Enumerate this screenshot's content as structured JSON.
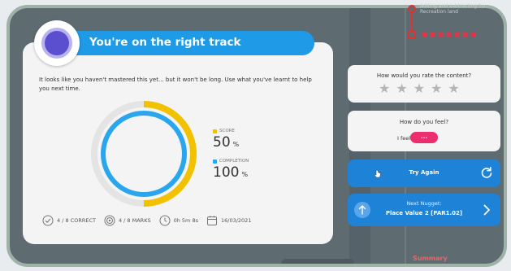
{
  "progress": {
    "nugget_title": "Adding and subtracting fro... Recreation land",
    "dot_count": 7
  },
  "result": {
    "title": "You're on the right track",
    "message": "It looks like you haven't mastered this yet... but it won't be long. Use what you've learnt to help you next time.",
    "score": {
      "label": "SCORE",
      "value": "50",
      "unit": "%",
      "fraction": 0.5,
      "color": "#f2c200"
    },
    "completion": {
      "label": "COMPLETION",
      "value": "100",
      "unit": "%",
      "fraction": 1.0,
      "color": "#2aa6ee"
    },
    "footer": {
      "correct": "4 / 8 CORRECT",
      "marks": "4 / 8 MARKS",
      "time": "0h 5m 8s",
      "date": "16/03/2021"
    }
  },
  "rating": {
    "question": "How would you rate the content?",
    "stars": 5,
    "selected": 0
  },
  "feeling": {
    "question": "How do you feel?",
    "prefix": "I feel",
    "selected": "..."
  },
  "actions": {
    "try_again": "Try Again",
    "next_label": "Next Nugget:",
    "next_title": "Place Value 2 [PAR1.02]"
  },
  "nav": {
    "summary": "Summary"
  },
  "colors": {
    "accent": "#1e9ae6",
    "button": "#1e82d6",
    "pink": "#ec2d6e",
    "frame": "#9fb2a8"
  }
}
